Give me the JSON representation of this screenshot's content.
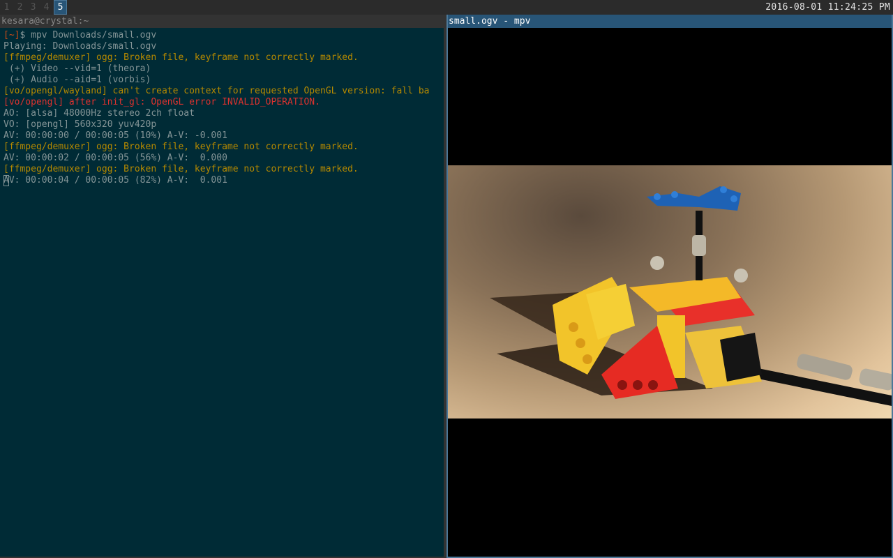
{
  "topbar": {
    "workspaces": [
      {
        "label": "1",
        "active": false
      },
      {
        "label": "2",
        "active": false
      },
      {
        "label": "3",
        "active": false
      },
      {
        "label": "4",
        "active": false
      },
      {
        "label": "5",
        "active": true
      }
    ],
    "clock": "2016-08-01 11:24:25 PM"
  },
  "terminal": {
    "title": "kesara@crystal:~",
    "prompt": "[~]",
    "prompt_symbol": "$ ",
    "command": "mpv Downloads/small.ogv",
    "lines": [
      {
        "text": "Playing: Downloads/small.ogv",
        "color": "default"
      },
      {
        "text": "[ffmpeg/demuxer] ogg: Broken file, keyframe not correctly marked.",
        "color": "yellow"
      },
      {
        "text": " (+) Video --vid=1 (theora)",
        "color": "default"
      },
      {
        "text": " (+) Audio --aid=1 (vorbis)",
        "color": "default"
      },
      {
        "text": "[vo/opengl/wayland] can't create context for requested OpenGL version: fall ba",
        "color": "yellow"
      },
      {
        "text": "[vo/opengl] after init_gl: OpenGL error INVALID_OPERATION.",
        "color": "red"
      },
      {
        "text": "AO: [alsa] 48000Hz stereo 2ch float",
        "color": "default"
      },
      {
        "text": "VO: [opengl] 560x320 yuv420p",
        "color": "default"
      },
      {
        "text": "AV: 00:00:00 / 00:00:05 (10%) A-V: -0.001",
        "color": "default"
      },
      {
        "text": "[ffmpeg/demuxer] ogg: Broken file, keyframe not correctly marked.",
        "color": "yellow"
      },
      {
        "text": "AV: 00:00:02 / 00:00:05 (56%) A-V:  0.000",
        "color": "default"
      },
      {
        "text": "[ffmpeg/demuxer] ogg: Broken file, keyframe not correctly marked.",
        "color": "yellow"
      }
    ],
    "status_line": {
      "cursor_char": "A",
      "rest": "V: 00:00:04 / 00:00:05 (82%) A-V:  0.001"
    }
  },
  "mpv": {
    "title": "small.ogv - mpv",
    "video_description": "LEGO Technic model with blue propeller on yellow and red frame",
    "progress_percent": 82
  },
  "colors": {
    "focused_border": "#4c7899",
    "focused_title_bg": "#285577",
    "terminal_bg": "#002b36",
    "terminal_fg": "#839496",
    "warn": "#b58900",
    "error": "#dc322f"
  }
}
